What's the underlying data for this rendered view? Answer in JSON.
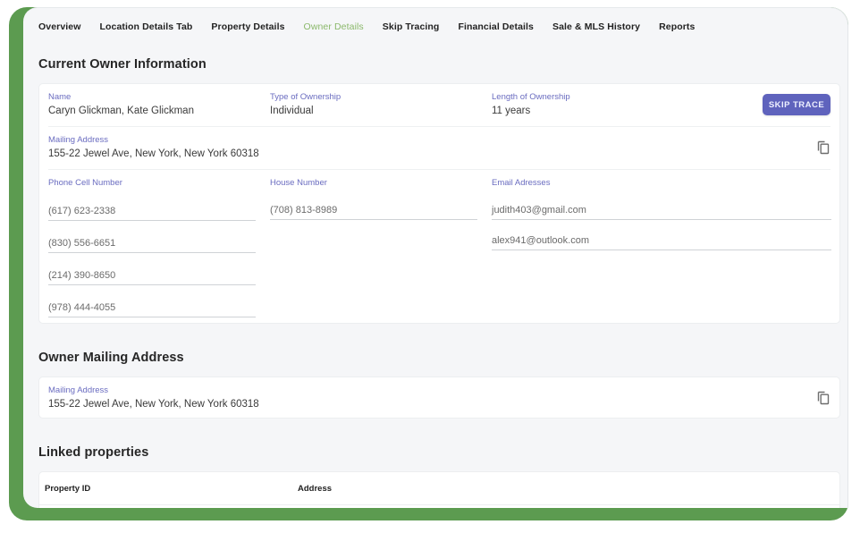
{
  "tabs": [
    {
      "label": "Overview",
      "active": false
    },
    {
      "label": "Location Details Tab",
      "active": false
    },
    {
      "label": "Property Details",
      "active": false
    },
    {
      "label": "Owner Details",
      "active": true
    },
    {
      "label": "Skip Tracing",
      "active": false
    },
    {
      "label": "Financial Details",
      "active": false
    },
    {
      "label": "Sale & MLS History",
      "active": false
    },
    {
      "label": "Reports",
      "active": false
    }
  ],
  "current_owner": {
    "title": "Current Owner Information",
    "name_label": "Name",
    "name_value": "Caryn Glickman, Kate Glickman",
    "ownership_type_label": "Type of Ownership",
    "ownership_type_value": "Individual",
    "ownership_length_label": "Length of Ownership",
    "ownership_length_value": "11 years",
    "skip_trace_button": "SKIP TRACE",
    "mailing_label": "Mailing Address",
    "mailing_value": "155-22 Jewel Ave, New York, New York 60318",
    "copy_icon": "copy-icon",
    "phone_label": "Phone Cell Number",
    "phones": [
      "(617) 623-2338",
      "(830) 556-6651",
      "(214) 390-8650",
      "(978) 444-4055"
    ],
    "house_label": "House Number",
    "house_numbers": [
      "(708) 813-8989"
    ],
    "email_label": "Email Adresses",
    "emails": [
      "judith403@gmail.com",
      "alex941@outlook.com"
    ]
  },
  "owner_mailing": {
    "title": "Owner Mailing Address",
    "label": "Mailing Address",
    "value": "155-22 Jewel Ave, New York, New York 60318",
    "copy_icon": "copy-icon"
  },
  "linked_properties": {
    "title": "Linked properties",
    "columns": [
      "Property ID",
      "Address"
    ]
  },
  "colors": {
    "frame_green": "#5c9b50",
    "active_tab": "#8ab86a",
    "label_purple": "#6a6cc0",
    "button_purple": "#5f63bd"
  }
}
